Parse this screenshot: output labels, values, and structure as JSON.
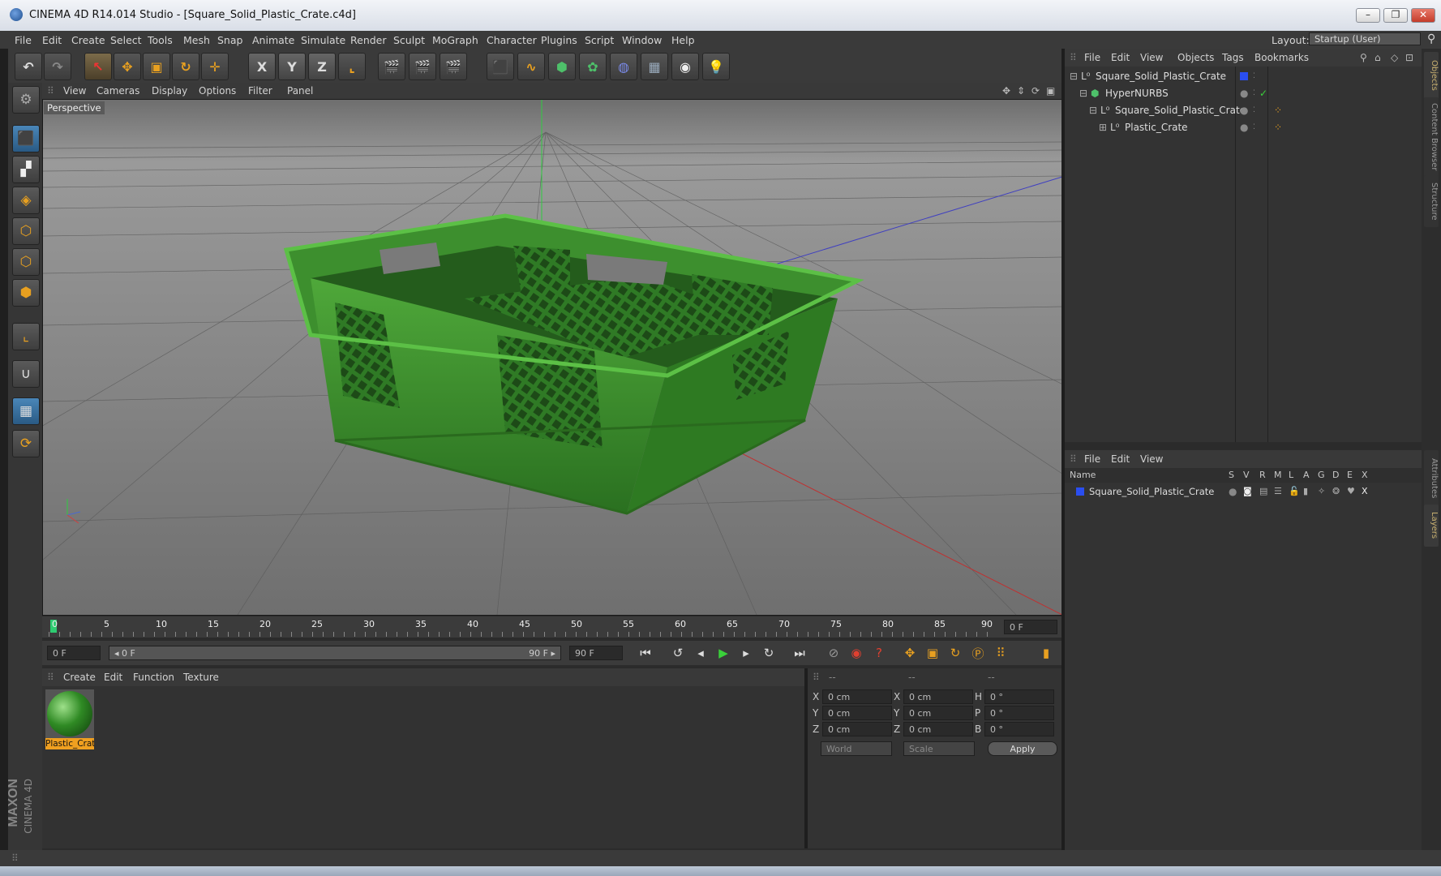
{
  "window": {
    "title": "CINEMA 4D R14.014 Studio - [Square_Solid_Plastic_Crate.c4d]",
    "controls": [
      "–",
      "❐",
      "✕"
    ]
  },
  "menubar": {
    "items": [
      "File",
      "Edit",
      "Create",
      "Select",
      "Tools",
      "Mesh",
      "Snap",
      "Animate",
      "Simulate",
      "Render",
      "Sculpt",
      "MoGraph",
      "Character",
      "Plugins",
      "Script",
      "Window",
      "Help"
    ],
    "layout_label": "Layout:",
    "layout_value": "Startup (User)"
  },
  "toolbar": {
    "axis_x": "X",
    "axis_y": "Y",
    "axis_z": "Z"
  },
  "viewport": {
    "menu": [
      "View",
      "Cameras",
      "Display",
      "Options",
      "Filter",
      "Panel"
    ],
    "label": "Perspective",
    "model_color": "#3a8a2a"
  },
  "timeline": {
    "ticks": [
      "0",
      "5",
      "10",
      "15",
      "20",
      "25",
      "30",
      "35",
      "40",
      "45",
      "50",
      "55",
      "60",
      "65",
      "70",
      "75",
      "80",
      "85",
      "90"
    ],
    "current_frame": "0 F"
  },
  "playback": {
    "start_field": "0 F",
    "range_start": "◂ 0 F",
    "range_end": "90 F ▸",
    "end_field": "90 F"
  },
  "material_manager": {
    "menu": [
      "Create",
      "Edit",
      "Function",
      "Texture"
    ],
    "materials": [
      {
        "name": "Plastic_Crat"
      }
    ]
  },
  "coordinates": {
    "headers": [
      "--",
      "--",
      "--"
    ],
    "rows": [
      {
        "a": "X",
        "a_val": "0 cm",
        "b": "X",
        "b_val": "0 cm",
        "c": "H",
        "c_val": "0 °"
      },
      {
        "a": "Y",
        "a_val": "0 cm",
        "b": "Y",
        "b_val": "0 cm",
        "c": "P",
        "c_val": "0 °"
      },
      {
        "a": "Z",
        "a_val": "0 cm",
        "b": "Z",
        "b_val": "0 cm",
        "c": "B",
        "c_val": "0 °"
      }
    ],
    "mode1": "World",
    "mode2": "Scale",
    "apply": "Apply"
  },
  "object_manager": {
    "menu": [
      "File",
      "Edit",
      "View",
      "Objects",
      "Tags",
      "Bookmarks"
    ],
    "objects": [
      {
        "name": "Square_Solid_Plastic_Crate"
      },
      {
        "name": "HyperNURBS"
      },
      {
        "name": "Square_Solid_Plastic_Crate"
      },
      {
        "name": "Plastic_Crate"
      }
    ]
  },
  "layer_manager": {
    "menu": [
      "File",
      "Edit",
      "View"
    ],
    "col_name": "Name",
    "cols": [
      "S",
      "V",
      "R",
      "M",
      "L",
      "A",
      "G",
      "D",
      "E",
      "X"
    ],
    "layers": [
      {
        "name": "Square_Solid_Plastic_Crate"
      }
    ]
  },
  "side_tabs": [
    "Objects",
    "Content Browser",
    "Structure",
    "Attributes",
    "Layers"
  ],
  "branding": {
    "line1": "MAXON",
    "line2": "CINEMA 4D"
  }
}
